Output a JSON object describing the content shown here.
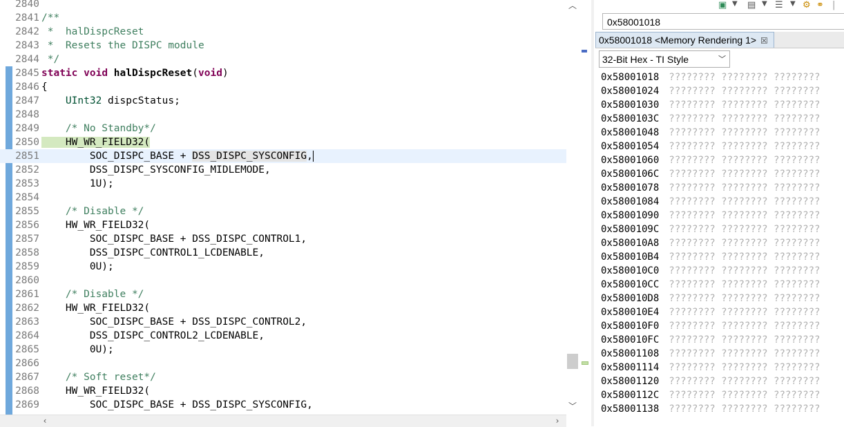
{
  "editor": {
    "lines": [
      {
        "num": "2840",
        "tokens": []
      },
      {
        "num": "2841",
        "tokens": [
          {
            "t": "/**",
            "c": "cm"
          }
        ]
      },
      {
        "num": "2842",
        "tokens": [
          {
            "t": " *  halDispcReset",
            "c": "cm"
          }
        ]
      },
      {
        "num": "2843",
        "tokens": [
          {
            "t": " *  Resets the DISPC module",
            "c": "cm"
          }
        ]
      },
      {
        "num": "2844",
        "tokens": [
          {
            "t": " */",
            "c": "cm"
          }
        ]
      },
      {
        "num": "2845",
        "tokens": [
          {
            "t": "static",
            "c": "kw"
          },
          {
            "t": " "
          },
          {
            "t": "void",
            "c": "kw"
          },
          {
            "t": " "
          },
          {
            "t": "halDispcReset",
            "c": "bold"
          },
          {
            "t": "("
          },
          {
            "t": "void",
            "c": "kw"
          },
          {
            "t": ")"
          }
        ]
      },
      {
        "num": "2846",
        "tokens": [
          {
            "t": "{"
          }
        ]
      },
      {
        "num": "2847",
        "tokens": [
          {
            "t": "    "
          },
          {
            "t": "UInt32",
            "c": "ty"
          },
          {
            "t": " dispcStatus;"
          }
        ]
      },
      {
        "num": "2848",
        "tokens": []
      },
      {
        "num": "2849",
        "tokens": [
          {
            "t": "    "
          },
          {
            "t": "/* No Standby*/",
            "c": "cm"
          }
        ]
      },
      {
        "num": "2850",
        "tokens": [
          {
            "t": "    HW_WR_FIELD32(",
            "c": "hl-green"
          }
        ]
      },
      {
        "num": "2851",
        "current": true,
        "tokens": [
          {
            "t": "        SOC_DISPC_BASE + "
          },
          {
            "t": "DSS_DISPC_SYSCONFIG",
            "c": "hl-grey"
          },
          {
            "t": ","
          },
          {
            "t": "",
            "c": "caret"
          }
        ]
      },
      {
        "num": "2852",
        "tokens": [
          {
            "t": "        DSS_DISPC_SYSCONFIG_MIDLEMODE,"
          }
        ]
      },
      {
        "num": "2853",
        "tokens": [
          {
            "t": "        1U);"
          }
        ]
      },
      {
        "num": "2854",
        "tokens": []
      },
      {
        "num": "2855",
        "tokens": [
          {
            "t": "    "
          },
          {
            "t": "/* Disable */",
            "c": "cm"
          }
        ]
      },
      {
        "num": "2856",
        "tokens": [
          {
            "t": "    HW_WR_FIELD32("
          }
        ]
      },
      {
        "num": "2857",
        "tokens": [
          {
            "t": "        SOC_DISPC_BASE + DSS_DISPC_CONTROL1,"
          }
        ]
      },
      {
        "num": "2858",
        "tokens": [
          {
            "t": "        DSS_DISPC_CONTROL1_LCDENABLE,"
          }
        ]
      },
      {
        "num": "2859",
        "tokens": [
          {
            "t": "        0U);"
          }
        ]
      },
      {
        "num": "2860",
        "tokens": []
      },
      {
        "num": "2861",
        "tokens": [
          {
            "t": "    "
          },
          {
            "t": "/* Disable */",
            "c": "cm"
          }
        ]
      },
      {
        "num": "2862",
        "tokens": [
          {
            "t": "    HW_WR_FIELD32("
          }
        ]
      },
      {
        "num": "2863",
        "tokens": [
          {
            "t": "        SOC_DISPC_BASE + DSS_DISPC_CONTROL2,"
          }
        ]
      },
      {
        "num": "2864",
        "tokens": [
          {
            "t": "        DSS_DISPC_CONTROL2_LCDENABLE,"
          }
        ]
      },
      {
        "num": "2865",
        "tokens": [
          {
            "t": "        0U);"
          }
        ]
      },
      {
        "num": "2866",
        "tokens": []
      },
      {
        "num": "2867",
        "tokens": [
          {
            "t": "    "
          },
          {
            "t": "/* Soft reset*/",
            "c": "cm"
          }
        ]
      },
      {
        "num": "2868",
        "tokens": [
          {
            "t": "    HW_WR_FIELD32("
          }
        ]
      },
      {
        "num": "2869",
        "tokens": [
          {
            "t": "        SOC_DISPC_BASE + DSS_DISPC_SYSCONFIG,"
          }
        ]
      }
    ],
    "scroll_up_icon": "chevron-up-icon",
    "scroll_down_icon": "chevron-down-icon",
    "scroll_left_icon": "chevron-left-icon",
    "scroll_right_icon": "chevron-right-icon"
  },
  "memory": {
    "address_input": "0x58001018",
    "tab_label": "0x58001018 <Memory Rendering 1>",
    "format": "32-Bit Hex - TI Style",
    "rows": [
      {
        "addr": "0x58001018",
        "vals": "???????? ???????? ????????"
      },
      {
        "addr": "0x58001024",
        "vals": "???????? ???????? ????????"
      },
      {
        "addr": "0x58001030",
        "vals": "???????? ???????? ????????"
      },
      {
        "addr": "0x5800103C",
        "vals": "???????? ???????? ????????"
      },
      {
        "addr": "0x58001048",
        "vals": "???????? ???????? ????????"
      },
      {
        "addr": "0x58001054",
        "vals": "???????? ???????? ????????"
      },
      {
        "addr": "0x58001060",
        "vals": "???????? ???????? ????????"
      },
      {
        "addr": "0x5800106C",
        "vals": "???????? ???????? ????????"
      },
      {
        "addr": "0x58001078",
        "vals": "???????? ???????? ????????"
      },
      {
        "addr": "0x58001084",
        "vals": "???????? ???????? ????????"
      },
      {
        "addr": "0x58001090",
        "vals": "???????? ???????? ????????"
      },
      {
        "addr": "0x5800109C",
        "vals": "???????? ???????? ????????"
      },
      {
        "addr": "0x580010A8",
        "vals": "???????? ???????? ????????"
      },
      {
        "addr": "0x580010B4",
        "vals": "???????? ???????? ????????"
      },
      {
        "addr": "0x580010C0",
        "vals": "???????? ???????? ????????"
      },
      {
        "addr": "0x580010CC",
        "vals": "???????? ???????? ????????"
      },
      {
        "addr": "0x580010D8",
        "vals": "???????? ???????? ????????"
      },
      {
        "addr": "0x580010E4",
        "vals": "???????? ???????? ????????"
      },
      {
        "addr": "0x580010F0",
        "vals": "???????? ???????? ????????"
      },
      {
        "addr": "0x580010FC",
        "vals": "???????? ???????? ????????"
      },
      {
        "addr": "0x58001108",
        "vals": "???????? ???????? ????????"
      },
      {
        "addr": "0x58001114",
        "vals": "???????? ???????? ????????"
      },
      {
        "addr": "0x58001120",
        "vals": "???????? ???????? ????????"
      },
      {
        "addr": "0x5800112C",
        "vals": "???????? ???????? ????????"
      },
      {
        "addr": "0x58001138",
        "vals": "???????? ???????? ????????"
      }
    ],
    "toolbar_icons": [
      "new-memory-monitor-icon",
      "dropdown-arrow-icon",
      "import-icon",
      "dropdown-arrow-icon",
      "export-icon",
      "dropdown-arrow-icon",
      "refresh-icon",
      "link-icon"
    ]
  },
  "colors": {
    "keyword": "#7f0055",
    "comment": "#3f7f5f",
    "type": "#005032",
    "gutter_bar": "#6fa8dc",
    "current_line": "#e8f2fe",
    "unknown_memory": "#b0b0b0"
  }
}
